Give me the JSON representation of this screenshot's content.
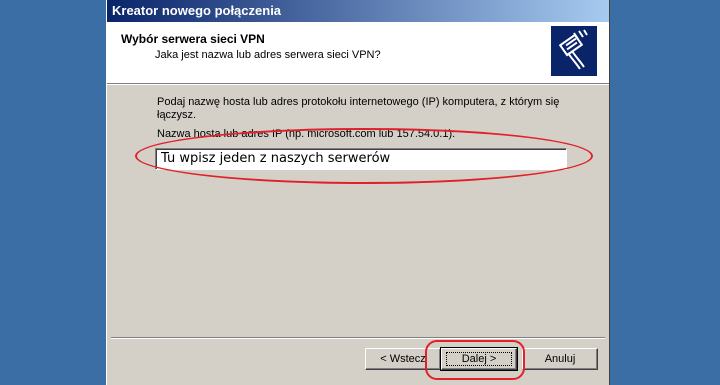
{
  "window": {
    "title": "Kreator nowego połączenia"
  },
  "header": {
    "heading": "Wybór serwera sieci VPN",
    "subheading": "Jaka jest nazwa lub adres serwera sieci VPN?",
    "icon": "network-plug-icon"
  },
  "body": {
    "description": "Podaj nazwę hosta lub adres protokołu internetowego (IP) komputera, z którym się łączysz.",
    "field_label": "Nazwa hosta lub adres IP (np. microsoft.com lub 157.54.0.1):",
    "field_value": "Tu wpisz jeden z naszych serwerów"
  },
  "buttons": {
    "back": "< Wstecz",
    "next": "Dalej >",
    "cancel": "Anuluj"
  },
  "colors": {
    "desktop": "#3a6ea5",
    "dialog": "#d4d0c8",
    "title_start": "#0a246a",
    "title_end": "#a6caf0",
    "annotation": "#e0202a"
  }
}
